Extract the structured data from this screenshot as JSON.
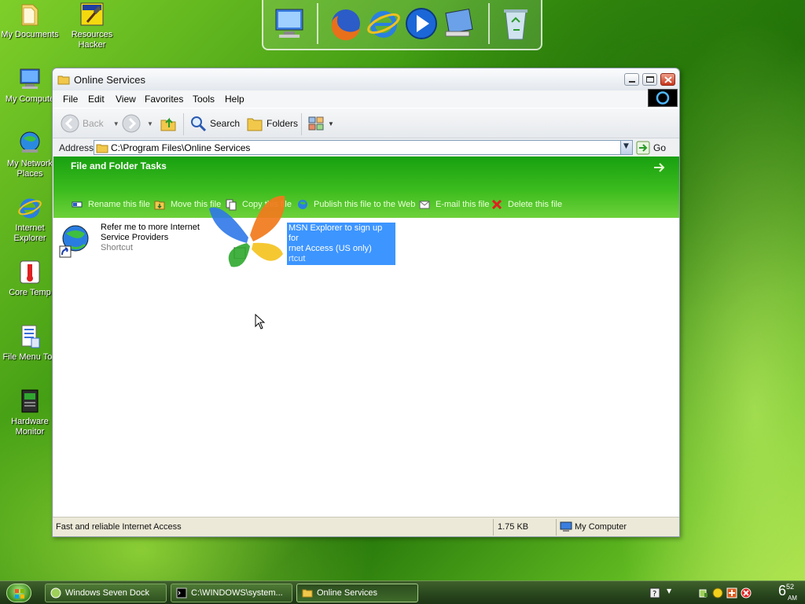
{
  "desktop": {
    "icons": [
      {
        "label": "My Documents",
        "icon": "folder-documents-icon"
      },
      {
        "label": "Resources",
        "label2": "Hacker",
        "icon": "hammer-icon"
      },
      {
        "label": "My Compute",
        "icon": "computer-icon"
      },
      {
        "label": "My Network",
        "label2": "Places",
        "icon": "network-globe-icon"
      },
      {
        "label": "Internet",
        "label2": "Explorer",
        "icon": "internet-explorer-icon"
      },
      {
        "label": "Core Temp",
        "icon": "thermometer-icon"
      },
      {
        "label": "File Menu Too",
        "icon": "document-icon"
      },
      {
        "label": "Hardware",
        "label2": "Monitor",
        "icon": "chip-icon"
      }
    ]
  },
  "dock": {
    "items": [
      "computer-icon",
      "firefox-icon",
      "internet-explorer-icon",
      "media-player-icon",
      "control-panel-icon",
      "recycle-bin-icon"
    ]
  },
  "window": {
    "title": "Online Services",
    "menu": [
      "File",
      "Edit",
      "View",
      "Favorites",
      "Tools",
      "Help"
    ],
    "toolbar": {
      "back": "Back",
      "search": "Search",
      "folders": "Folders"
    },
    "address": {
      "label": "Address",
      "value": "C:\\Program Files\\Online Services",
      "go": "Go"
    },
    "tasks": {
      "header": "File and Folder Tasks",
      "items": [
        "Rename this file",
        "Move this file",
        "Copy this file",
        "Publish this file to the Web",
        "E-mail this file",
        "Delete this file"
      ]
    },
    "files": [
      {
        "name1": "Refer me to more Internet",
        "name2": "Service Providers",
        "type": "Shortcut"
      },
      {
        "name1": "MSN Explorer to sign up for",
        "name2": "rnet Access (US only)",
        "type": "rtcut"
      }
    ],
    "status": {
      "text": "Fast and reliable Internet Access",
      "size": "1.75 KB",
      "zone": "My Computer"
    }
  },
  "taskbar": {
    "tasks": [
      {
        "label": "Windows Seven Dock"
      },
      {
        "label": "C:\\WINDOWS\\system..."
      },
      {
        "label": "Online Services"
      }
    ],
    "clock": {
      "hour": "6",
      "minute": "52",
      "ampm": "AM"
    }
  },
  "colors": {
    "task_pane_green": "#3cbc1e",
    "selection_blue": "#3d95ff",
    "taskbar_green": "#2b4a1f"
  }
}
